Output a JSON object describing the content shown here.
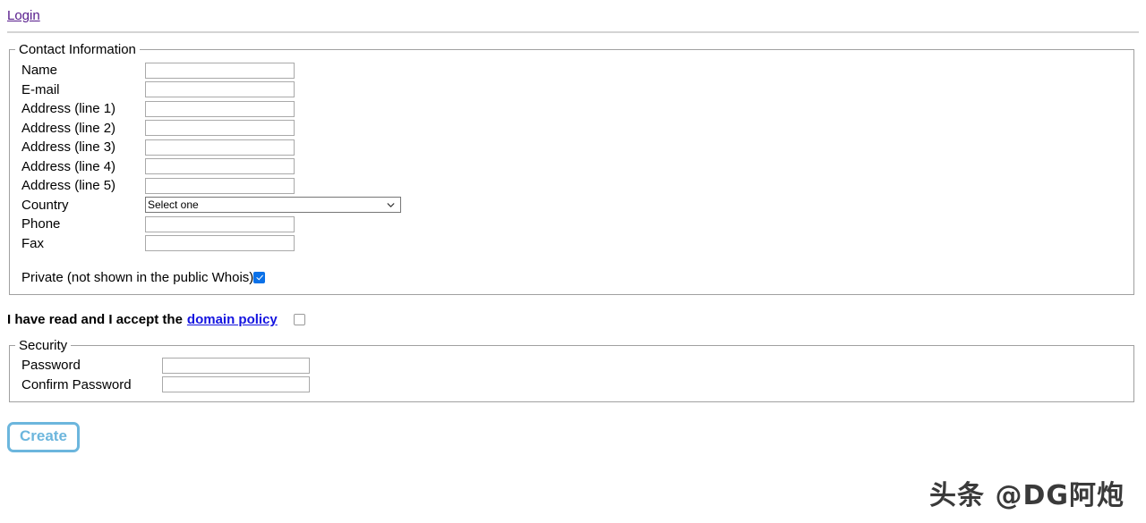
{
  "page": {
    "login_link": "Login"
  },
  "contact_section": {
    "legend": "Contact Information",
    "fields": [
      {
        "label": "Name",
        "value": "",
        "type": "text"
      },
      {
        "label": "E-mail",
        "value": "",
        "type": "text"
      },
      {
        "label": "Address (line 1)",
        "value": "",
        "type": "text"
      },
      {
        "label": "Address (line 2)",
        "value": "",
        "type": "text"
      },
      {
        "label": "Address (line 3)",
        "value": "",
        "type": "text"
      },
      {
        "label": "Address (line 4)",
        "value": "",
        "type": "text"
      },
      {
        "label": "Address (line 5)",
        "value": "",
        "type": "text"
      }
    ],
    "country": {
      "label": "Country",
      "selected": "Select one",
      "options": [
        "Select one"
      ],
      "arrow_icon": "chevron-down-icon"
    },
    "phone": {
      "label": "Phone",
      "value": ""
    },
    "fax": {
      "label": "Fax",
      "value": ""
    },
    "private": {
      "label": "Private (not shown in the public Whois)",
      "checked": true
    }
  },
  "policy": {
    "text_before": "I have read and I accept the",
    "link_text": "domain policy",
    "checked": false
  },
  "security_section": {
    "legend": "Security",
    "fields": [
      {
        "label": "Password",
        "value": "",
        "type": "password"
      },
      {
        "label": "Confirm Password",
        "value": "",
        "type": "password"
      }
    ]
  },
  "actions": {
    "create_label": "Create"
  },
  "watermark": {
    "text": "头条 @DG阿炮"
  },
  "colors": {
    "visited_link": "#551a8b",
    "policy_link": "#1414e0",
    "checkbox_checked": "#0b71e8",
    "button_accent": "#6cb6dd",
    "fieldset_border": "#a0a0a0",
    "divider": "#d4d4d4"
  }
}
